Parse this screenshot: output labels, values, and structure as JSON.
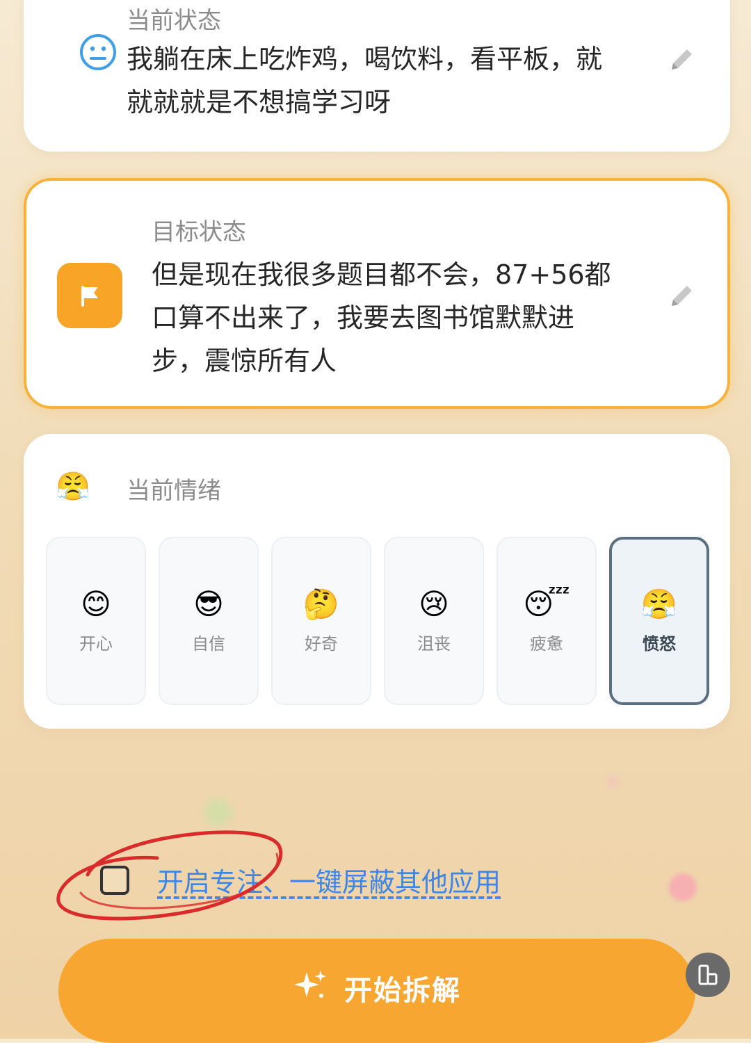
{
  "current_state": {
    "label": "当前状态",
    "text_line1": "我躺在床上吃炸鸡，喝饮料，看平板，就",
    "text_line2": "就就就是不想搞学习呀",
    "icon": "neutral-face-icon"
  },
  "target_state": {
    "label": "目标状态",
    "text_line1": "但是现在我很多题目都不会，87+56都",
    "text_line2": "口算不出来了，我要去图书馆默默进",
    "text_line3": "步，震惊所有人",
    "icon": "flag-icon",
    "accent": "#f7a427"
  },
  "emotion": {
    "label": "当前情绪",
    "header_emoji": "😤",
    "options": [
      {
        "emoji": "😊",
        "label": "开心"
      },
      {
        "emoji": "😎",
        "label": "自信"
      },
      {
        "emoji": "🤔",
        "label": "好奇"
      },
      {
        "emoji": "😢",
        "label": "沮丧"
      },
      {
        "emoji": "😴",
        "label": "疲惫"
      },
      {
        "emoji": "😤",
        "label": "愤怒"
      }
    ],
    "selected": "愤怒"
  },
  "focus": {
    "label": "开启专注、一键屏蔽其他应用",
    "checked": false
  },
  "start_button": {
    "label": "开始拆解",
    "icon": "sparkle-icon",
    "color": "#f7a731"
  },
  "floating_button": {
    "icon": "window-layout-icon"
  }
}
